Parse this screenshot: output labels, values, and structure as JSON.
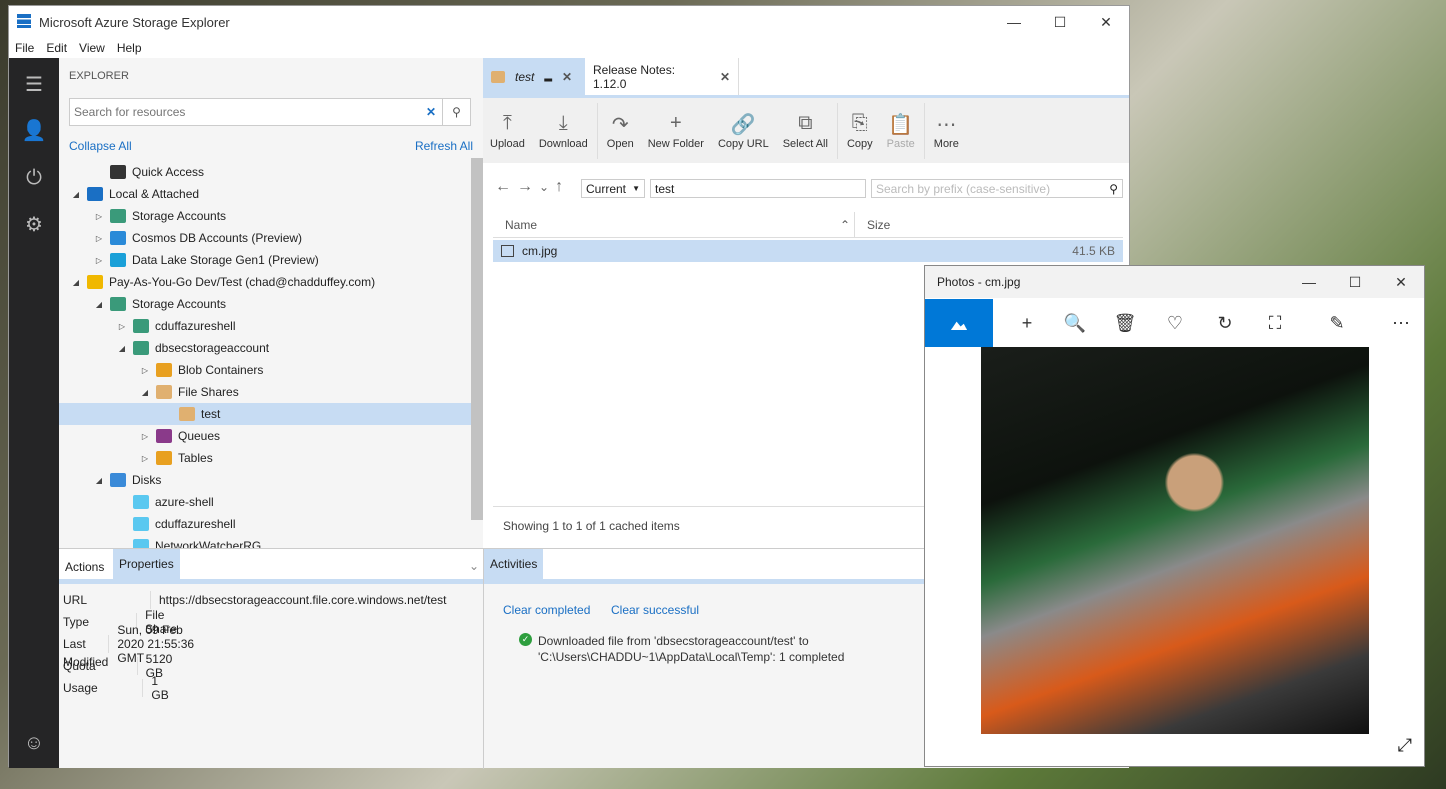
{
  "window": {
    "title": "Microsoft Azure Storage Explorer",
    "minimize": "—",
    "maximize": "☐",
    "close": "✕"
  },
  "menu": [
    "File",
    "Edit",
    "View",
    "Help"
  ],
  "rail": [
    {
      "icon": "explorer-icon",
      "g": "☰"
    },
    {
      "icon": "account-icon",
      "g": "👤"
    },
    {
      "icon": "plug-icon",
      "g": "⏻"
    },
    {
      "icon": "gear-icon",
      "g": "⚙"
    },
    {
      "icon": "feedback-icon",
      "g": "☺"
    }
  ],
  "explorer": {
    "heading": "EXPLORER",
    "search_placeholder": "Search for resources",
    "collapse_all": "Collapse All",
    "refresh_all": "Refresh All",
    "tree": [
      {
        "label": "Quick Access",
        "indent": 1,
        "arrow": "",
        "icon": "quick-access-icon",
        "color": "#333"
      },
      {
        "label": "Local & Attached",
        "indent": 0,
        "arrow": "◢",
        "icon": "link-icon",
        "color": "#1a6fc4"
      },
      {
        "label": "Storage Accounts",
        "indent": 1,
        "arrow": "▷",
        "icon": "storage-account-icon",
        "color": "#3a9a7a"
      },
      {
        "label": "Cosmos DB Accounts (Preview)",
        "indent": 1,
        "arrow": "▷",
        "icon": "cosmos-db-icon",
        "color": "#2a8ad8"
      },
      {
        "label": "Data Lake Storage Gen1 (Preview)",
        "indent": 1,
        "arrow": "▷",
        "icon": "data-lake-icon",
        "color": "#1aa0d8"
      },
      {
        "label": "Pay-As-You-Go Dev/Test (chad@chadduffey.com)",
        "indent": 0,
        "arrow": "◢",
        "icon": "key-icon",
        "color": "#f0b800"
      },
      {
        "label": "Storage Accounts",
        "indent": 1,
        "arrow": "◢",
        "icon": "storage-account-icon",
        "color": "#3a9a7a"
      },
      {
        "label": "cduffazureshell",
        "indent": 2,
        "arrow": "▷",
        "icon": "storage-account-icon",
        "color": "#3a9a7a"
      },
      {
        "label": "dbsecstorageaccount",
        "indent": 2,
        "arrow": "◢",
        "icon": "storage-account-icon",
        "color": "#3a9a7a"
      },
      {
        "label": "Blob Containers",
        "indent": 3,
        "arrow": "▷",
        "icon": "blob-container-icon",
        "color": "#e8a020"
      },
      {
        "label": "File Shares",
        "indent": 3,
        "arrow": "◢",
        "icon": "file-share-icon",
        "color": "#e0b070"
      },
      {
        "label": "test",
        "indent": 4,
        "arrow": "",
        "icon": "file-share-icon",
        "color": "#e0b070",
        "selected": true
      },
      {
        "label": "Queues",
        "indent": 3,
        "arrow": "▷",
        "icon": "queue-icon",
        "color": "#8a3a8a"
      },
      {
        "label": "Tables",
        "indent": 3,
        "arrow": "▷",
        "icon": "table-icon",
        "color": "#e8a020"
      },
      {
        "label": "Disks",
        "indent": 1,
        "arrow": "◢",
        "icon": "disk-icon",
        "color": "#3a8ad8"
      },
      {
        "label": "azure-shell",
        "indent": 2,
        "arrow": "",
        "icon": "disk-group-icon",
        "color": "#5ac8f0"
      },
      {
        "label": "cduffazureshell",
        "indent": 2,
        "arrow": "",
        "icon": "disk-group-icon",
        "color": "#5ac8f0"
      },
      {
        "label": "NetworkWatcherRG",
        "indent": 2,
        "arrow": "",
        "icon": "disk-group-icon",
        "color": "#5ac8f0"
      }
    ]
  },
  "tabs": [
    {
      "label": "test",
      "active": true
    },
    {
      "label": "Release Notes: 1.12.0",
      "active": false
    }
  ],
  "toolbar": [
    {
      "label": "Upload",
      "g": "⤒"
    },
    {
      "label": "Download",
      "g": "⤓"
    },
    {
      "sep": true
    },
    {
      "label": "Open",
      "g": "↷"
    },
    {
      "label": "New Folder",
      "g": "+"
    },
    {
      "label": "Copy URL",
      "g": "🔗"
    },
    {
      "label": "Select All",
      "g": "⧉"
    },
    {
      "sep": true
    },
    {
      "label": "Copy",
      "g": "⎘"
    },
    {
      "label": "Paste",
      "g": "📋",
      "disabled": true
    },
    {
      "sep": true
    },
    {
      "label": "More",
      "g": "⋯"
    }
  ],
  "address": {
    "scope": "Current",
    "path": "test",
    "search_placeholder": "Search by prefix (case-sensitive)"
  },
  "files": {
    "columns": [
      "Name",
      "Size"
    ],
    "rows": [
      {
        "name": "cm.jpg",
        "size": "41.5 KB"
      }
    ],
    "status": "Showing 1 to 1 of 1 cached items"
  },
  "bottom": {
    "tabs": [
      "Actions",
      "Properties"
    ],
    "activities_tab": "Activities",
    "properties": [
      {
        "k": "URL",
        "v": "https://dbsecstorageaccount.file.core.windows.net/test"
      },
      {
        "k": "Type",
        "v": "File Share"
      },
      {
        "k": "Last Modified",
        "v": "Sun, 09 Feb 2020 21:55:36 GMT"
      },
      {
        "k": "Quota",
        "v": "5120 GB"
      },
      {
        "k": "Usage",
        "v": "1 GB"
      }
    ],
    "clear_completed": "Clear completed",
    "clear_successful": "Clear successful",
    "activity_line1": "Downloaded file from 'dbsecstorageaccount/test' to",
    "activity_line2": "'C:\\Users\\CHADDU~1\\AppData\\Local\\Temp': 1 completed"
  },
  "photos": {
    "title": "Photos - cm.jpg",
    "tools": [
      {
        "icon": "add-icon",
        "g": "+"
      },
      {
        "icon": "zoom-in-icon",
        "g": "🔍"
      },
      {
        "icon": "delete-icon",
        "g": "🗑"
      },
      {
        "icon": "favorite-icon",
        "g": "♡"
      },
      {
        "icon": "rotate-icon",
        "g": "↻"
      },
      {
        "icon": "crop-icon",
        "g": "⛶"
      },
      {
        "icon": "edit-icon",
        "g": "✎"
      },
      {
        "icon": "more-icon",
        "g": "⋯"
      }
    ],
    "accent": "#0078d7"
  }
}
